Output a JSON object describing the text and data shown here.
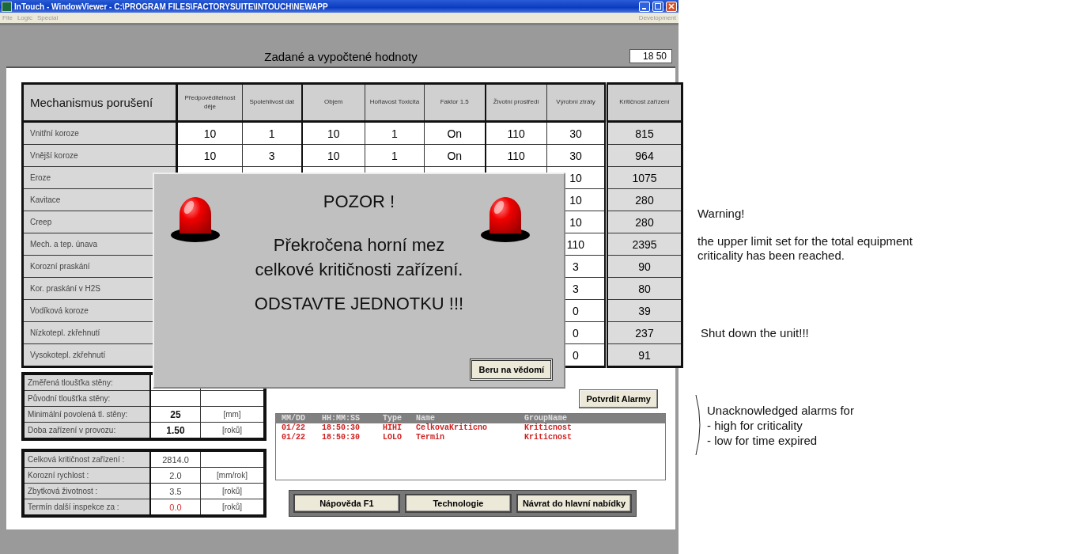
{
  "window": {
    "title": "InTouch - WindowViewer - C:\\PROGRAM FILES\\FACTORYSUITE\\INTOUCH\\NEWAPP",
    "menu": [
      "File",
      "Logic",
      "Special"
    ],
    "menu_right": "Development"
  },
  "header": {
    "title": "Zadané a vypočtené hodnoty",
    "time": "18 50"
  },
  "table": {
    "columns": [
      "Mechanismus porušení",
      "Předpověditelnost děje",
      "Spolehlivost dat",
      "Objem",
      "Hořlavost Toxicita",
      "Faktor 1.5",
      "Životní prostředí",
      "Výrobní ztráty",
      "Kritičnost zařízení"
    ],
    "rows": [
      {
        "name": "Vnitřní koroze",
        "values": [
          "10",
          "1",
          "10",
          "1",
          "On",
          "110"
        ],
        "production_loss": "30",
        "criticality": "815"
      },
      {
        "name": "Vnější koroze",
        "values": [
          "10",
          "3",
          "10",
          "1",
          "On",
          "110"
        ],
        "production_loss": "30",
        "criticality": "964"
      },
      {
        "name": "Eroze",
        "production_loss": "10",
        "criticality": "1075"
      },
      {
        "name": "Kavitace",
        "production_loss": "10",
        "criticality": "280"
      },
      {
        "name": "Creep",
        "production_loss": "10",
        "criticality": "280"
      },
      {
        "name": "Mech. a tep. únava",
        "production_loss": "110",
        "criticality": "2395"
      },
      {
        "name": "Korozní praskání",
        "production_loss": "3",
        "criticality": "90"
      },
      {
        "name": "Kor. praskání v H2S",
        "production_loss": "3",
        "criticality": "80"
      },
      {
        "name": "Vodíková koroze",
        "production_loss": "0",
        "criticality": "39"
      },
      {
        "name": "Nízkotepl. zkřehnutí",
        "production_loss": "0",
        "criticality": "237"
      },
      {
        "name": "Vysokotepl. zkřehnutí",
        "production_loss": "0",
        "criticality": "91"
      }
    ]
  },
  "wall_panel": {
    "rows": [
      {
        "label": "Změřená tloušťka stěny:"
      },
      {
        "label": "Původní tloušťka stěny:"
      },
      {
        "label": "Minimální povolená tl. stěny:",
        "value": "25",
        "unit": "[mm]"
      },
      {
        "label": "Doba zařízení v provozu:",
        "value": "1.50",
        "unit": "[roků]"
      }
    ]
  },
  "result_panel": {
    "rows": [
      {
        "label": "Celková kritičnost zařízení :",
        "value": "2814.0",
        "warning": false
      },
      {
        "label": "Korozní rychlost :",
        "value": "2.0",
        "unit": "[mm/rok]",
        "warning": false
      },
      {
        "label": "Zbytková životnost :",
        "value": "3.5",
        "unit": "[roků]",
        "warning": false
      },
      {
        "label": "Termín další inspekce za :",
        "value": "0.0",
        "unit": "[roků]",
        "warning": true
      }
    ]
  },
  "dialog": {
    "title": "POZOR !",
    "message_lines": [
      "Překročena horní mez",
      "celkové kritičnosti zařízení."
    ],
    "command": "ODSTAVTE JEDNOTKU !!!",
    "button": "Beru na vědomí"
  },
  "acknowledge_button": "Potvrdit Alarmy",
  "alarm_list": {
    "columns": [
      "MM/DD",
      "HH:MM:SS",
      "Type",
      "Name",
      "GroupName"
    ],
    "rows": [
      [
        "01/22",
        "18:50:30",
        "HIHI",
        "CelkovaKriticno",
        "Kriticnost"
      ],
      [
        "01/22",
        "18:50:30",
        "LOLO",
        "Termin",
        "Kriticnost"
      ]
    ]
  },
  "nav_buttons": [
    "Nápověda F1",
    "Technologie",
    "Návrat do hlavní nabídky"
  ],
  "notes": {
    "warning": "Warning!",
    "message": "the upper limit set for the total equipment criticality has been reached.",
    "action": "Shut down the unit!!!",
    "alarms": [
      "Unacknowledged alarms for",
      "- high for criticality",
      "- low for time expired"
    ]
  }
}
